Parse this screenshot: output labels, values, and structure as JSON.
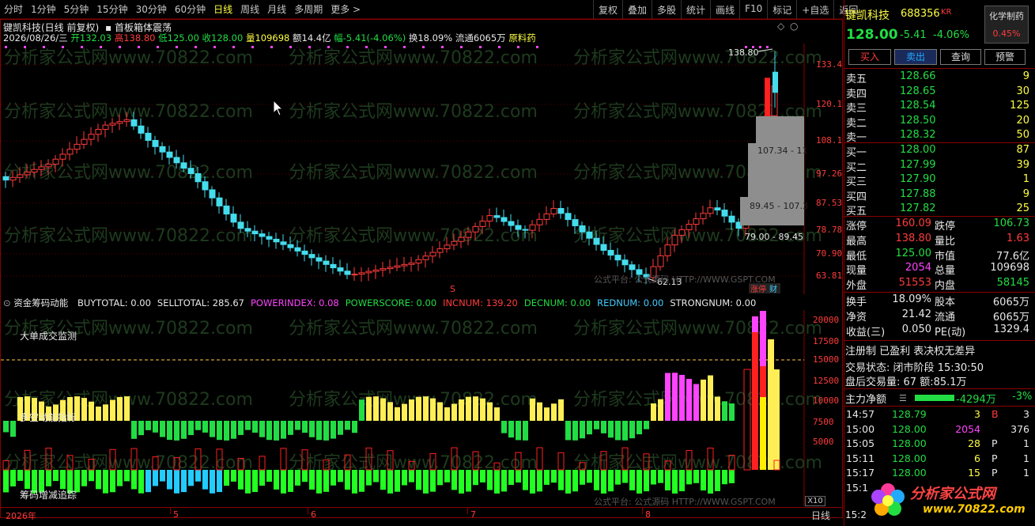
{
  "menu": {
    "periods": [
      "分时",
      "1分钟",
      "5分钟",
      "15分钟",
      "30分钟",
      "60分钟",
      "日线",
      "周线",
      "月线",
      "多周期",
      "更多"
    ],
    "active": "日线",
    "more_arrow": ">",
    "tools": [
      "复权",
      "叠加",
      "多股",
      "统计",
      "画线",
      "F10",
      "标记",
      "+自选",
      "返回"
    ]
  },
  "chart": {
    "title": "键凯科技(日线 前复权)",
    "indicator_name": "首板箱体震荡",
    "info": {
      "date": "2026/08/26/三",
      "open_label": "开",
      "open": "132.03",
      "high_label": "高",
      "high": "138.80",
      "low_label": "低",
      "low": "125.00",
      "close_label": "收",
      "close": "128.00",
      "vol_label": "量",
      "vol": "109698",
      "amt_label": "额",
      "amt": "14.4亿",
      "amp_label": "幅",
      "amp": "-5.41(-4.06%)",
      "turn_label": "换",
      "turn": "18.09%",
      "float_label": "流通",
      "float": "6065万",
      "concept": "原料药"
    },
    "price_axis": [
      "133.4",
      "120.1",
      "108.1",
      "97.26",
      "87.53",
      "78.78",
      "70.90",
      "63.81"
    ],
    "annotations": {
      "high_mark": "138.80",
      "low_mark": "62.13",
      "box1": "107.34 - 11",
      "box2": "89.45 - 107.3",
      "box3": "79.00 - 89.45",
      "tag": "涨停",
      "tag2": "财"
    },
    "watermark": "分析家公式网www.70822.com",
    "site_mark": "公式平台: 公式源码 HTTP://WWW.GSPT.COM",
    "s_mark": "S"
  },
  "indicator": {
    "name": "资金筹码动能",
    "fields": [
      {
        "label": "BUYTOTAL:",
        "value": "0.00",
        "color": "#e8e8e8"
      },
      {
        "label": "SELLTOTAL:",
        "value": "285.67",
        "color": "#e8e8e8"
      },
      {
        "label": "POWERINDEX:",
        "value": "0.08",
        "color": "#ff44ff"
      },
      {
        "label": "POWERSCORE:",
        "value": "0.00",
        "color": "#22dd44"
      },
      {
        "label": "INCNUM:",
        "value": "139.20",
        "color": "#ff3b3b"
      },
      {
        "label": "DECNUM:",
        "value": "0.00",
        "color": "#22dd44"
      },
      {
        "label": "REDNUM:",
        "value": "0.00",
        "color": "#44ccff"
      },
      {
        "label": "STRONGNUM:",
        "value": "0.00",
        "color": "#e8e8e8"
      }
    ],
    "axis": [
      "20000",
      "17500",
      "15000",
      "12500",
      "10000",
      "7500",
      "5000"
    ],
    "labels": [
      "大单成交监测",
      "多空动能指标",
      "筹码增减追踪"
    ],
    "multiplier": "X10"
  },
  "time_axis": {
    "labels": [
      "2026年",
      "5",
      "6",
      "7",
      "8"
    ],
    "period": "日线"
  },
  "panel": {
    "name": "键凯科技",
    "code": "688356",
    "market_tag": "KR",
    "price": "128.00",
    "change": "-5.41",
    "change_pct": "-4.06%",
    "sector": "化学制药",
    "sector_pct": "0.45%",
    "buttons": [
      "买入",
      "卖出",
      "查询",
      "预警"
    ],
    "asks": [
      {
        "label": "卖五",
        "price": "128.66",
        "vol": "9"
      },
      {
        "label": "卖四",
        "price": "128.65",
        "vol": "30"
      },
      {
        "label": "卖三",
        "price": "128.54",
        "vol": "125"
      },
      {
        "label": "卖二",
        "price": "128.50",
        "vol": "20"
      },
      {
        "label": "卖一",
        "price": "128.32",
        "vol": "50"
      }
    ],
    "bids": [
      {
        "label": "买一",
        "price": "128.00",
        "vol": "87"
      },
      {
        "label": "买二",
        "price": "127.99",
        "vol": "39"
      },
      {
        "label": "买三",
        "price": "127.90",
        "vol": "1"
      },
      {
        "label": "买四",
        "price": "127.88",
        "vol": "9"
      },
      {
        "label": "买五",
        "price": "127.82",
        "vol": "25"
      }
    ],
    "stats": [
      {
        "l1": "涨停",
        "v1": "160.09",
        "c1": "#ff3b3b",
        "l2": "跌停",
        "v2": "106.73",
        "c2": "#22dd44"
      },
      {
        "l1": "最高",
        "v1": "138.80",
        "c1": "#ff3b3b",
        "l2": "量比",
        "v2": "1.63",
        "c2": "#ff3b3b"
      },
      {
        "l1": "最低",
        "v1": "125.00",
        "c1": "#22dd44",
        "l2": "市值",
        "v2": "77.6亿",
        "c2": "#e8e8e8"
      },
      {
        "l1": "现量",
        "v1": "2054",
        "c1": "#ff44ff",
        "l2": "总量",
        "v2": "109698",
        "c2": "#e8e8e8"
      },
      {
        "l1": "外盘",
        "v1": "51553",
        "c1": "#ff3b3b",
        "l2": "内盘",
        "v2": "58145",
        "c2": "#22dd44"
      }
    ],
    "stats2": [
      {
        "l1": "换手",
        "v1": "18.09%",
        "l2": "股本",
        "v2": "6065万"
      },
      {
        "l1": "净资",
        "v1": "21.42",
        "l2": "流通",
        "v2": "6065万"
      },
      {
        "l1": "收益(三)",
        "v1": "0.050",
        "l2": "PE(动)",
        "v2": "1329.4"
      }
    ],
    "tags": "注册制 已盈利 表决权无差异",
    "trade_status_label": "交易状态:",
    "trade_status": "闭市阶段",
    "trade_time": "15:30:50",
    "after_label": "盘后交易量:",
    "after_vol": "67",
    "after_amt_label": "额:",
    "after_amt": "85.1万",
    "main_flow_label": "主力净额",
    "main_flow": "-4294万",
    "main_flow_pct": "-3%",
    "ticks": [
      {
        "time": "14:57",
        "price": "128.79",
        "vol": "3",
        "side": "B",
        "extra": "3"
      },
      {
        "time": "15:00",
        "price": "128.00",
        "vol": "2054",
        "side": "",
        "extra": "376"
      },
      {
        "time": "15:05",
        "price": "128.00",
        "vol": "28",
        "side": "P",
        "extra": "1"
      },
      {
        "time": "15:11",
        "price": "128.00",
        "vol": "6",
        "side": "P",
        "extra": "1"
      },
      {
        "time": "15:17",
        "price": "128.00",
        "vol": "15",
        "side": "P",
        "extra": "1"
      },
      {
        "time": "15:1",
        "price": "",
        "vol": "",
        "side": "",
        "extra": ""
      }
    ],
    "last_time": "15:2",
    "logo": "分析家公式网",
    "logo_url": "www.70822.com"
  }
}
